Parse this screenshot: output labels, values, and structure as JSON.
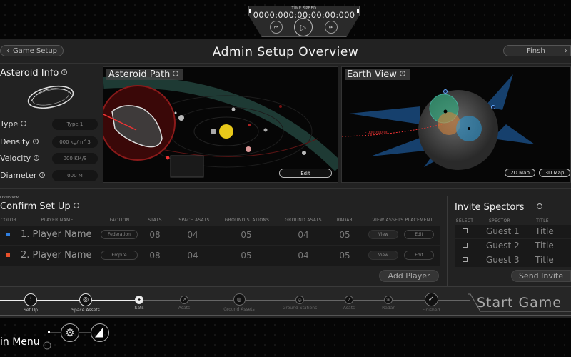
{
  "time_widget": {
    "label": "TIME SPEED",
    "clock": "0000:000:00:00:00:000",
    "icons": [
      "step-back-icon",
      "play-icon",
      "step-forward-icon"
    ]
  },
  "header": {
    "back_label": "Game Setup",
    "title": "Admin Setup Overview",
    "finish_label": "Finsh"
  },
  "asteroid_info": {
    "title": "Asteroid Info",
    "fields": [
      {
        "label": "Type",
        "value": "Type 1"
      },
      {
        "label": "Density",
        "value": "000 kg/m^3"
      },
      {
        "label": "Velocity",
        "value": "000 KM/S"
      },
      {
        "label": "Diameter",
        "value": "000 M"
      }
    ]
  },
  "asteroid_path": {
    "title": "Asteroid Path",
    "edit_label": "Edit"
  },
  "earth_view": {
    "title": "Earth View",
    "trajectory_label": "T - 0000:00:00",
    "map2d_label": "2D Map",
    "map3d_label": "3D Map"
  },
  "setup": {
    "overline": "Overview",
    "title": "Confirm Set Up",
    "columns": [
      "COLOR",
      "PLAYER NAME",
      "FACTION",
      "STATS",
      "SPACE ASATS",
      "GROUND STATIONS",
      "GROUND ASATS",
      "RADAR",
      "VIEW ASSETS PLACEMENT"
    ],
    "players": [
      {
        "color": "#2f7fe0",
        "name": "1. Player Name",
        "faction": "Federation",
        "stats": "08",
        "space_asats": "04",
        "ground_stations": "05",
        "ground_asats": "04",
        "radar": "05",
        "view": "View",
        "edit": "Edit"
      },
      {
        "color": "#e8502a",
        "name": "2. Player Name",
        "faction": "Empire",
        "stats": "08",
        "space_asats": "04",
        "ground_stations": "05",
        "ground_asats": "04",
        "radar": "05",
        "view": "View",
        "edit": "Edit"
      }
    ],
    "add_label": "Add Player"
  },
  "invite": {
    "title": "Invite Spectors",
    "columns": [
      "SELECT",
      "SPECTOR",
      "TITLE"
    ],
    "guests": [
      {
        "name": "Guest 1",
        "title": "Title"
      },
      {
        "name": "Guest 2",
        "title": "Title"
      },
      {
        "name": "Guest 3",
        "title": "Title"
      }
    ],
    "send_label": "Send Invite"
  },
  "progress": {
    "steps": [
      {
        "label": "Set Up",
        "state": "done"
      },
      {
        "label": "Space Assets",
        "state": "done"
      },
      {
        "label": "Sats",
        "state": "current"
      },
      {
        "label": "Asats",
        "state": "pending"
      },
      {
        "label": "Ground Assets",
        "state": "pending"
      },
      {
        "label": "Ground Stations",
        "state": "pending"
      },
      {
        "label": "Asats",
        "state": "pending"
      },
      {
        "label": "Radar",
        "state": "pending"
      },
      {
        "label": "Finished",
        "state": "pending"
      }
    ],
    "start_label": "Start Game"
  },
  "footer": {
    "menu_label": "in Menu"
  }
}
